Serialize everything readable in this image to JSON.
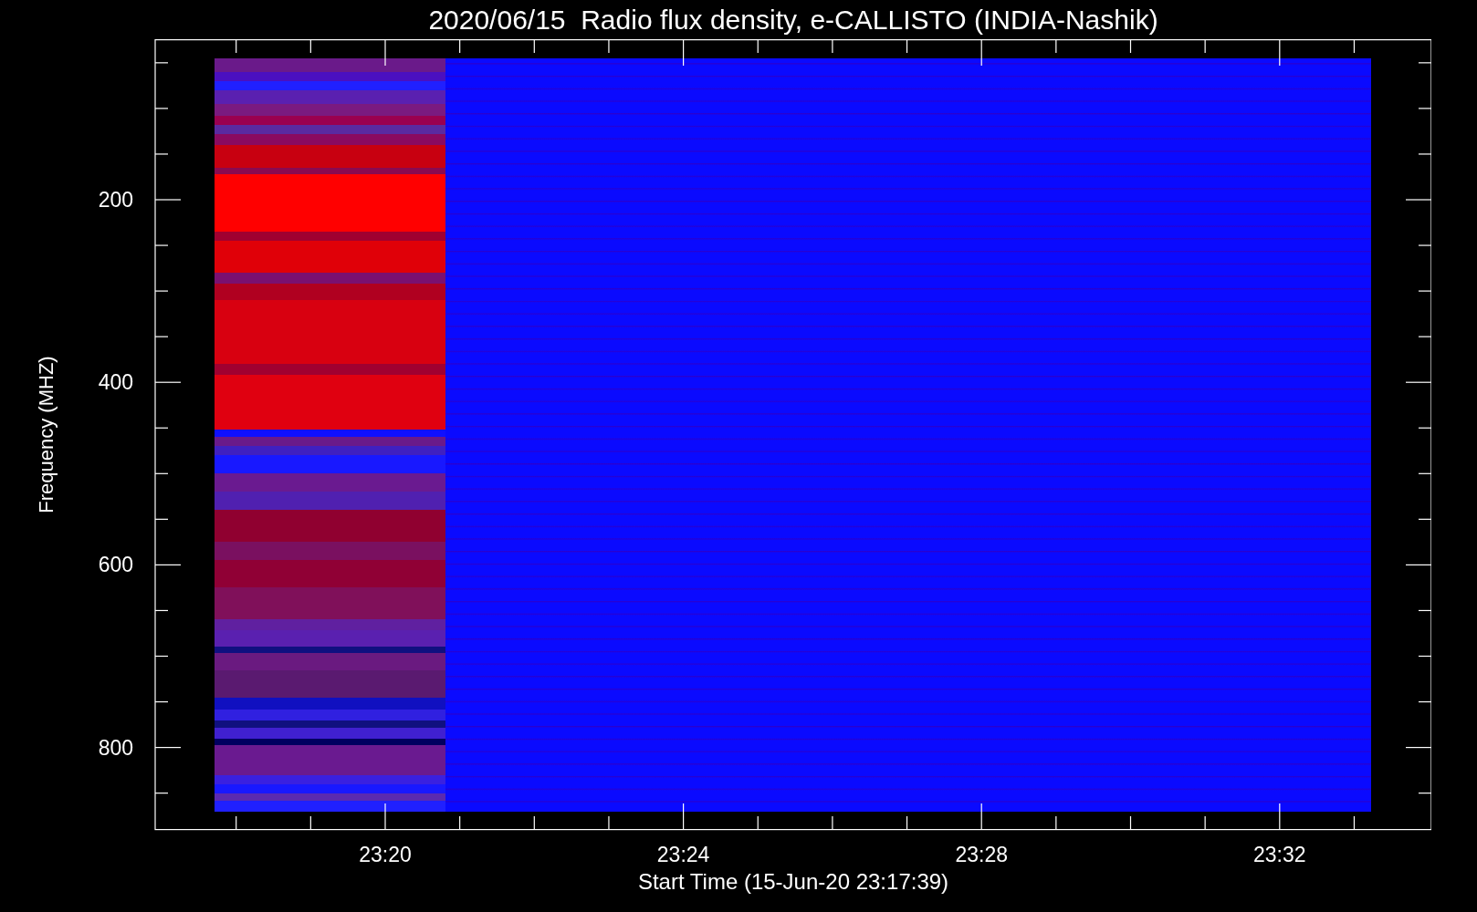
{
  "title": "2020/06/15  Radio flux density, e-CALLISTO (INDIA-Nashik)",
  "y_axis": {
    "label": "Frequency (MHZ)",
    "ticks": [
      "200",
      "400",
      "600",
      "800"
    ]
  },
  "x_axis": {
    "label": "Start Time (15-Jun-20 23:17:39)",
    "ticks": [
      "23:20",
      "23:24",
      "23:28",
      "23:32"
    ]
  }
}
